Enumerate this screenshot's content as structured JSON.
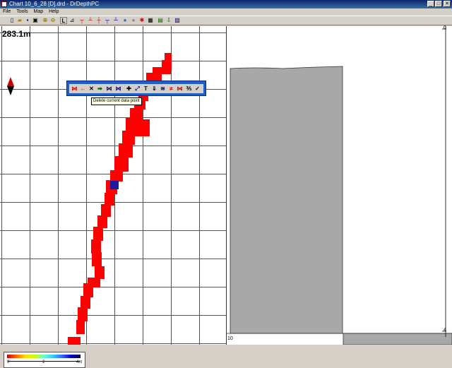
{
  "window": {
    "title": "Chart 10_6_28 [D].drd - DrDepthPC",
    "min_label": "_",
    "max_label": "□",
    "close_label": "✕"
  },
  "menu": [
    "File",
    "Tools",
    "Map",
    "Help"
  ],
  "toolbar": {
    "icons": [
      "new-icon",
      "open-icon",
      "save-icon",
      "export-icon",
      "zoom-in-icon",
      "zoom-out-icon",
      "select-icon",
      "marker-icon",
      "depth-icon",
      "line-icon",
      "line-marker-icon",
      "route-icon",
      "waypoint-icon",
      "settings-icon",
      "grid-icon",
      "track-icon",
      "layers-icon"
    ]
  },
  "chart": {
    "depth_label": "283.1m",
    "scale_labels": [
      "0",
      "2",
      "4m"
    ],
    "track_color": "#ff0000",
    "current_point_color": "#1a1a9a"
  },
  "data_toolbar": {
    "buttons": [
      "⋈",
      "←",
      "✕",
      "➡",
      "⋈",
      "⋈",
      "✚",
      "⤢",
      "T",
      "⇓",
      "≋",
      "≠",
      "⋈",
      "⅗",
      "✓"
    ],
    "tooltip": "Delete current data point"
  },
  "profile": {
    "x_label": "10",
    "depth_top": "0",
    "depth_bottom": "4",
    "fill_color": "#a8a8a8"
  }
}
